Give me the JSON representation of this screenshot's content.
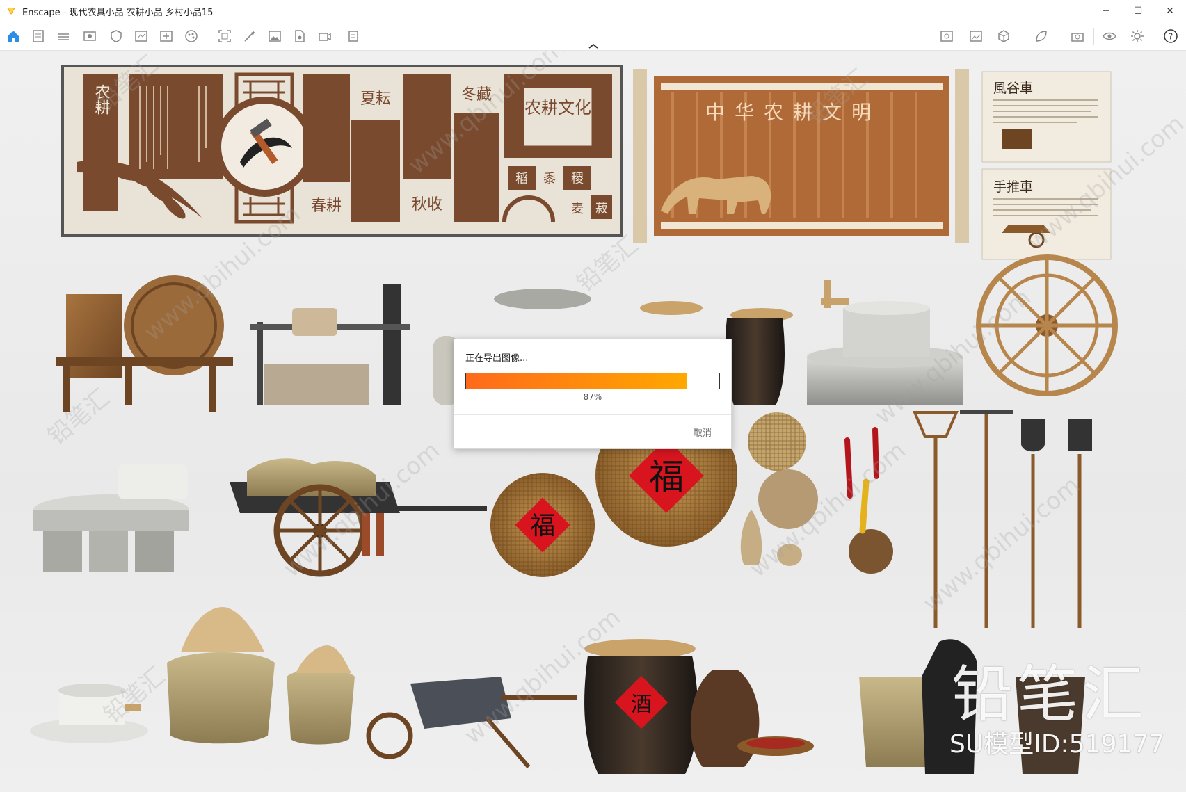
{
  "window": {
    "title": "Enscape - 现代农具小品 农耕小品 乡村小品15",
    "controls": {
      "minimize": "─",
      "maximize": "☐",
      "close": "✕"
    }
  },
  "toolbar": {
    "icons": [
      "home-icon",
      "document-icon",
      "bim-list-icon",
      "view-eye-icon",
      "shield-icon",
      "drawing-icon",
      "add-view-icon",
      "palette-icon",
      "capture-frame-icon",
      "magic-wand-icon",
      "image-icon",
      "file-icon",
      "video-camera-icon",
      "batch-render-icon",
      "export-image-icon",
      "screenshot-icon",
      "cube-icon",
      "leaf-icon",
      "camera-icon",
      "visibility-icon",
      "settings-icon",
      "help-icon"
    ],
    "help_label": "?"
  },
  "scene": {
    "panel_left": {
      "vertical_text_1": "农耕",
      "labels": [
        "夏耘",
        "冬藏",
        "春耕",
        "秋收"
      ],
      "emblem": "农耕文化",
      "grains": [
        "稻",
        "黍",
        "稷",
        "麦",
        "菽"
      ]
    },
    "panel_mid": {
      "heading": "中华农耕文明"
    },
    "panel_right": {
      "card1_title": "風谷車",
      "card2_title": "手推車"
    },
    "basket_label": "福",
    "jar_label": "酒"
  },
  "dialog": {
    "title": "正在导出图像...",
    "progress": 0.87,
    "progress_text": "87%",
    "cancel_label": "取消"
  },
  "watermark": {
    "brand": "铅笔汇",
    "url": "www.qbihui.com",
    "model_id": "SU模型ID:519177"
  },
  "colors": {
    "panel_brown": "#7a4a2e",
    "panel_cream": "#e9e2d6",
    "progress_start": "#ff6a1a",
    "progress_end": "#ffa800"
  }
}
